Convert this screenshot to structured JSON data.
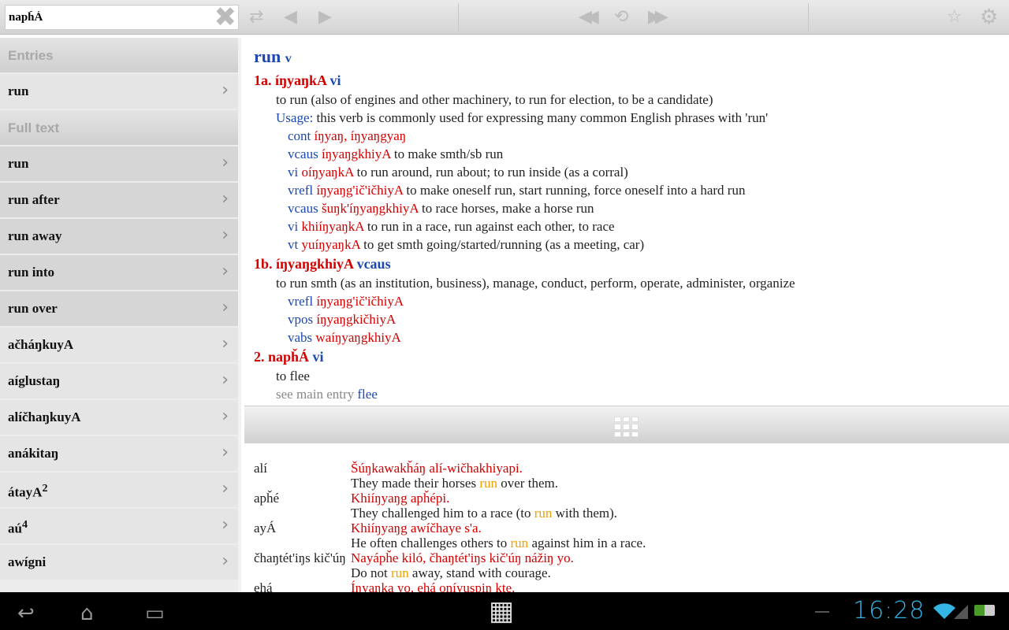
{
  "search": {
    "value": "napȟÁ"
  },
  "toolbar": {
    "clear": "✖",
    "sync": "⇄",
    "back": "◀",
    "forward": "▶",
    "rewind": "◀◀",
    "history": "⟲",
    "ffwd": "▶▶",
    "star": "☆",
    "settings": "⚙"
  },
  "sidebar": {
    "entries_header": "Entries",
    "entries": [
      {
        "label": "run"
      }
    ],
    "fulltext_header": "Full text",
    "fulltext": [
      {
        "label": "run",
        "hl": true
      },
      {
        "label": "run after",
        "hl": true
      },
      {
        "label": "run away",
        "hl": true
      },
      {
        "label": "run into",
        "hl": true
      },
      {
        "label": "run over",
        "hl": true
      },
      {
        "label": "ačháŋkuyA"
      },
      {
        "label": "aíglustaŋ"
      },
      {
        "label": "alíčhaŋkuyA"
      },
      {
        "label": "anákitaŋ"
      },
      {
        "label": "átayA",
        "sup": "2"
      },
      {
        "label": "aú",
        "sup": "4"
      },
      {
        "label": "awígni"
      }
    ]
  },
  "entry": {
    "headword": "run",
    "pos": "v",
    "lines": [
      {
        "cls": "sense",
        "segs": [
          [
            "red",
            "1a. íŋyaŋkA "
          ],
          [
            "blue",
            "vi"
          ]
        ]
      },
      {
        "cls": "l1",
        "segs": [
          [
            "",
            "to run (also of engines and other machinery, to run for election, to be a candidate)"
          ]
        ]
      },
      {
        "cls": "l1",
        "segs": [
          [
            "blue",
            "Usage: "
          ],
          [
            "",
            "this verb is commonly used for expressing many common English phrases with 'run'"
          ]
        ]
      },
      {
        "cls": "l2",
        "segs": [
          [
            "blue",
            "cont "
          ],
          [
            "red",
            "íŋyaŋ, íŋyaŋgyaŋ"
          ]
        ]
      },
      {
        "cls": "l2",
        "segs": [
          [
            "blue",
            "vcaus "
          ],
          [
            "red",
            "íŋyaŋgkhiyA"
          ],
          [
            "",
            " to make smth/sb run"
          ]
        ]
      },
      {
        "cls": "l2",
        "segs": [
          [
            "blue",
            "vi "
          ],
          [
            "red",
            "oíŋyaŋkA"
          ],
          [
            "",
            " to run around, run about; to run inside (as a corral)"
          ]
        ]
      },
      {
        "cls": "l2",
        "segs": [
          [
            "blue",
            "vrefl "
          ],
          [
            "red",
            "íŋyaŋg'ič'ičhiyA"
          ],
          [
            "",
            " to make oneself run, start running, force oneself into a hard run"
          ]
        ]
      },
      {
        "cls": "l2",
        "segs": [
          [
            "blue",
            "vcaus "
          ],
          [
            "red",
            "šuŋk'íŋyaŋgkhiyA"
          ],
          [
            "",
            " to race horses, make a horse run"
          ]
        ]
      },
      {
        "cls": "l2",
        "segs": [
          [
            "blue",
            "vi "
          ],
          [
            "red",
            "khiíŋyaŋkA"
          ],
          [
            "",
            " to run in a race, run against each other, to race"
          ]
        ]
      },
      {
        "cls": "l2",
        "segs": [
          [
            "blue",
            "vt "
          ],
          [
            "red",
            "yuíŋyaŋkA"
          ],
          [
            "",
            " to get smth going/started/running (as a meeting, car)"
          ]
        ]
      },
      {
        "cls": "sense",
        "segs": [
          [
            "red",
            "1b. íŋyaŋgkhiyA "
          ],
          [
            "blue",
            "vcaus"
          ]
        ]
      },
      {
        "cls": "l1",
        "segs": [
          [
            "",
            "to run smth (as an institution, business), manage, conduct, perform, operate, administer, organize"
          ]
        ]
      },
      {
        "cls": "l2",
        "segs": [
          [
            "blue",
            "vrefl "
          ],
          [
            "red",
            "íŋyaŋg'ič'ičhiyA"
          ]
        ]
      },
      {
        "cls": "l2",
        "segs": [
          [
            "blue",
            "vpos "
          ],
          [
            "red",
            "íŋyaŋgkičhiyA"
          ]
        ]
      },
      {
        "cls": "l2",
        "segs": [
          [
            "blue",
            "vabs "
          ],
          [
            "red",
            "waíŋyaŋgkhiyA"
          ]
        ]
      },
      {
        "cls": "sense",
        "segs": [
          [
            "red",
            "2.   napȟÁ "
          ],
          [
            "blue",
            "vi"
          ]
        ]
      },
      {
        "cls": "l1",
        "segs": [
          [
            "",
            "to flee"
          ]
        ]
      },
      {
        "cls": "l1",
        "segs": [
          [
            "gray",
            "see main entry "
          ],
          [
            "blue",
            "flee"
          ]
        ]
      }
    ]
  },
  "examples": [
    {
      "word": "alí",
      "lakota": "Šúŋkawakȟáŋ alí-wičhakhiyapi.",
      "english": [
        [
          "",
          "They made their horses "
        ],
        [
          "orange",
          "run"
        ],
        [
          "",
          " over them."
        ]
      ]
    },
    {
      "word": "apȟé",
      "lakota": "Khiíŋyaŋg apȟépi.",
      "english": [
        [
          "",
          "They challenged him to a race (to "
        ],
        [
          "orange",
          "run"
        ],
        [
          "",
          " with them)."
        ]
      ]
    },
    {
      "word": "ayÁ",
      "lakota": "Khiíŋyaŋg awíčhaye s'a.",
      "english": [
        [
          "",
          "He often challenges others to "
        ],
        [
          "orange",
          "run"
        ],
        [
          "",
          " against him in a race."
        ]
      ]
    },
    {
      "word": "čhaŋtét'iŋs kič'úŋ",
      "lakota": "Nayápȟe kiló, čhaŋtét'iŋs kič'úŋ nážiŋ yo.",
      "english": [
        [
          "",
          "Do not "
        ],
        [
          "orange",
          "run"
        ],
        [
          "",
          " away, stand with courage."
        ]
      ]
    },
    {
      "word": "ehá",
      "lakota": "Íŋyaŋka yo, ehá oníyuspiŋ kte.",
      "english": []
    }
  ],
  "statusbar": {
    "back": "↩",
    "home": "⌂",
    "recent": "▭",
    "apps": "▦",
    "clock": "16:28",
    "wifi": "wifi-icon",
    "battery": "battery-charging-icon"
  }
}
